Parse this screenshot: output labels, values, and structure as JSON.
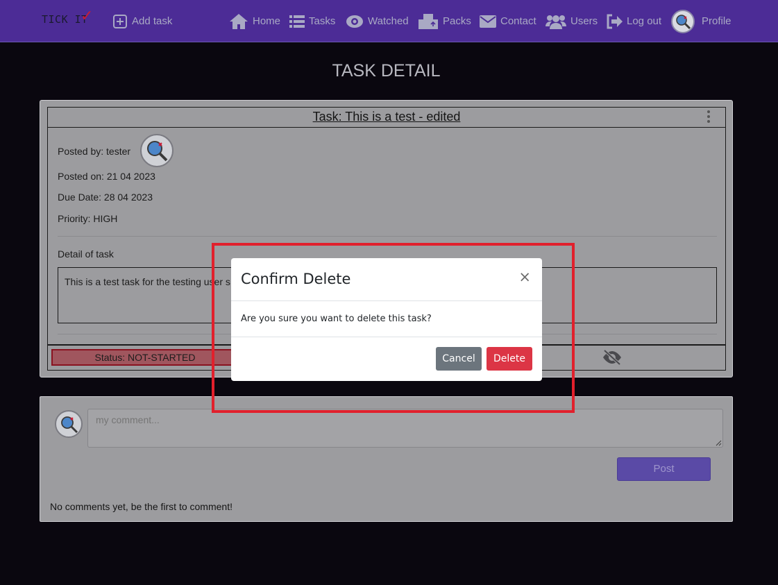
{
  "navbar": {
    "brand": "TICK IT",
    "brand_check": "✓",
    "add_task": "Add task",
    "home": "Home",
    "tasks": "Tasks",
    "watched": "Watched",
    "packs": "Packs",
    "contact": "Contact",
    "users": "Users",
    "logout": "Log out",
    "profile": "Profile"
  },
  "page": {
    "title": "TASK DETAIL"
  },
  "task": {
    "title": "Task: This is a test - edited",
    "posted_by": "Posted by: tester",
    "posted_on": "Posted on: 21 04 2023",
    "due_date": "Due Date: 28 04 2023",
    "priority": "Priority: HIGH",
    "detail_label": "Detail of task",
    "detail_text": "This is a test task for the testing user s",
    "status": "Status: NOT-STARTED"
  },
  "comments": {
    "placeholder": "my comment...",
    "post_label": "Post",
    "empty_text": "No comments yet, be the first to comment!"
  },
  "modal": {
    "title": "Confirm Delete",
    "close": "×",
    "body": "Are you sure you want to delete this task?",
    "cancel_label": "Cancel",
    "delete_label": "Delete"
  },
  "colors": {
    "navbar": "#4c2c96",
    "background": "#0a070f",
    "delete": "#dc3545",
    "cancel": "#6c757d",
    "highlight": "#e1202c"
  }
}
